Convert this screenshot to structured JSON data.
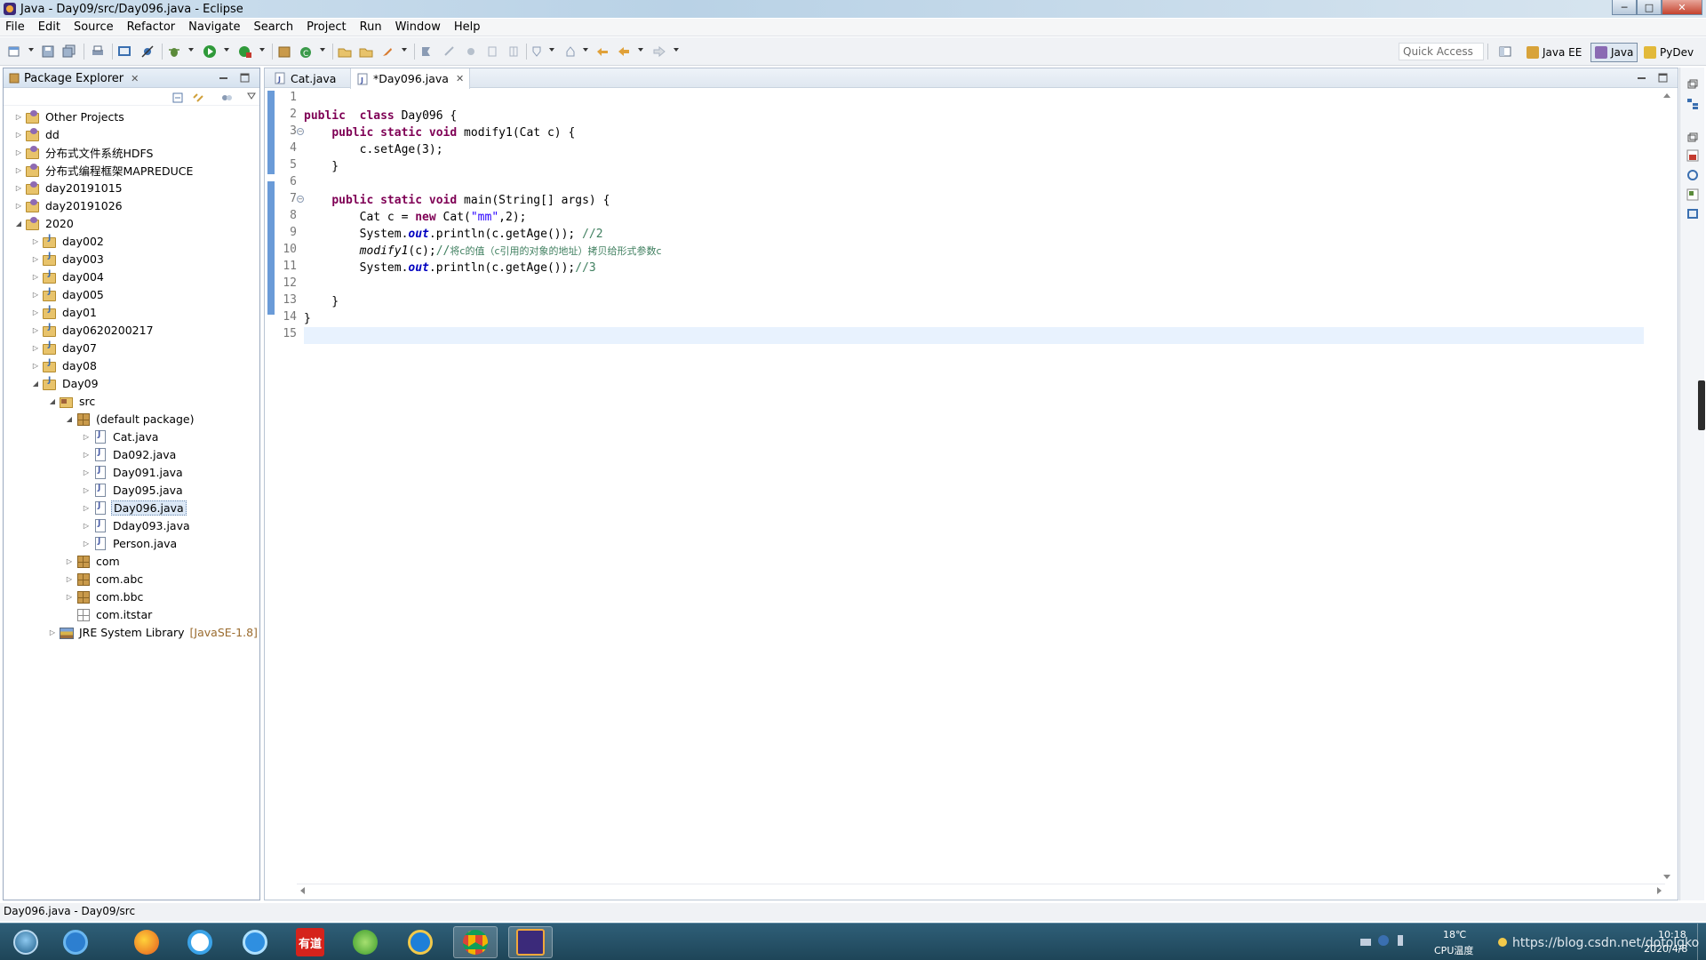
{
  "window": {
    "title": "Java - Day09/src/Day096.java - Eclipse",
    "min": "─",
    "max": "□",
    "close": "✕"
  },
  "menu": [
    "File",
    "Edit",
    "Source",
    "Refactor",
    "Navigate",
    "Search",
    "Project",
    "Run",
    "Window",
    "Help"
  ],
  "toolbar": {
    "quick_access": "Quick Access",
    "perspectives": [
      {
        "label": "Java EE",
        "icon": "java-ee-icon",
        "active": false
      },
      {
        "label": "Java",
        "icon": "java-perspective-icon",
        "active": true
      },
      {
        "label": "PyDev",
        "icon": "pydev-icon",
        "active": false
      }
    ]
  },
  "package_explorer": {
    "tab_label": "Package Explorer",
    "close": "✕",
    "tree": [
      {
        "label": "Other Projects",
        "depth": 0,
        "arrow": "▷",
        "icon": "project"
      },
      {
        "label": "dd",
        "depth": 0,
        "arrow": "▷",
        "icon": "project"
      },
      {
        "label": "分布式文件系统HDFS",
        "depth": 0,
        "arrow": "▷",
        "icon": "project"
      },
      {
        "label": "分布式编程框架MAPREDUCE",
        "depth": 0,
        "arrow": "▷",
        "icon": "project"
      },
      {
        "label": "day20191015",
        "depth": 0,
        "arrow": "▷",
        "icon": "project"
      },
      {
        "label": "day20191026",
        "depth": 0,
        "arrow": "▷",
        "icon": "project"
      },
      {
        "label": "2020",
        "depth": 0,
        "arrow": "◢",
        "icon": "project"
      },
      {
        "label": "day002",
        "depth": 1,
        "arrow": "▷",
        "icon": "jproject"
      },
      {
        "label": "day003",
        "depth": 1,
        "arrow": "▷",
        "icon": "jproject"
      },
      {
        "label": "day004",
        "depth": 1,
        "arrow": "▷",
        "icon": "jproject"
      },
      {
        "label": "day005",
        "depth": 1,
        "arrow": "▷",
        "icon": "jproject"
      },
      {
        "label": "day01",
        "depth": 1,
        "arrow": "▷",
        "icon": "jproject"
      },
      {
        "label": "day0620200217",
        "depth": 1,
        "arrow": "▷",
        "icon": "jproject"
      },
      {
        "label": "day07",
        "depth": 1,
        "arrow": "▷",
        "icon": "jproject"
      },
      {
        "label": "day08",
        "depth": 1,
        "arrow": "▷",
        "icon": "jproject"
      },
      {
        "label": "Day09",
        "depth": 1,
        "arrow": "◢",
        "icon": "jproject"
      },
      {
        "label": "src",
        "depth": 2,
        "arrow": "◢",
        "icon": "src"
      },
      {
        "label": "(default package)",
        "depth": 3,
        "arrow": "◢",
        "icon": "pkg"
      },
      {
        "label": "Cat.java",
        "depth": 4,
        "arrow": "▷",
        "icon": "java"
      },
      {
        "label": "Da092.java",
        "depth": 4,
        "arrow": "▷",
        "icon": "java"
      },
      {
        "label": "Day091.java",
        "depth": 4,
        "arrow": "▷",
        "icon": "java"
      },
      {
        "label": "Day095.java",
        "depth": 4,
        "arrow": "▷",
        "icon": "java"
      },
      {
        "label": "Day096.java",
        "depth": 4,
        "arrow": "▷",
        "icon": "java",
        "selected": true
      },
      {
        "label": "Dday093.java",
        "depth": 4,
        "arrow": "▷",
        "icon": "java"
      },
      {
        "label": "Person.java",
        "depth": 4,
        "arrow": "▷",
        "icon": "java"
      },
      {
        "label": "com",
        "depth": 3,
        "arrow": "▷",
        "icon": "pkg"
      },
      {
        "label": "com.abc",
        "depth": 3,
        "arrow": "▷",
        "icon": "pkg"
      },
      {
        "label": "com.bbc",
        "depth": 3,
        "arrow": "▷",
        "icon": "pkg"
      },
      {
        "label": "com.itstar",
        "depth": 3,
        "arrow": "",
        "icon": "pkg-empty"
      },
      {
        "label": "JRE System Library",
        "depth": 2,
        "arrow": "▷",
        "icon": "jre",
        "suffix": "[JavaSE-1.8]"
      }
    ]
  },
  "editor": {
    "tabs": [
      {
        "label": "Cat.java",
        "active": false,
        "close": ""
      },
      {
        "label": "*Day096.java",
        "active": true,
        "close": "✕"
      }
    ],
    "lines": [
      [],
      [
        [
          "kw",
          "public"
        ],
        [
          "",
          "  "
        ],
        [
          "kw",
          "class"
        ],
        [
          "",
          " Day096 {"
        ]
      ],
      [
        [
          "",
          "    "
        ],
        [
          "kw",
          "public"
        ],
        [
          "",
          " "
        ],
        [
          "kw",
          "static"
        ],
        [
          "",
          " "
        ],
        [
          "kw",
          "void"
        ],
        [
          "",
          " modify1(Cat c) {"
        ]
      ],
      [
        [
          "",
          "        c.setAge(3);"
        ]
      ],
      [
        [
          "",
          "    }"
        ]
      ],
      [],
      [
        [
          "",
          "    "
        ],
        [
          "kw",
          "public"
        ],
        [
          "",
          " "
        ],
        [
          "kw",
          "static"
        ],
        [
          "",
          " "
        ],
        [
          "kw",
          "void"
        ],
        [
          "",
          " main(String[] args) {"
        ]
      ],
      [
        [
          "",
          "        Cat c = "
        ],
        [
          "kw",
          "new"
        ],
        [
          "",
          " Cat("
        ],
        [
          "str",
          "\"mm\""
        ],
        [
          "",
          ",2);"
        ]
      ],
      [
        [
          "",
          "        System."
        ],
        [
          "fld",
          "out"
        ],
        [
          "",
          ".println(c.getAge()); "
        ],
        [
          "cmt",
          "//2"
        ]
      ],
      [
        [
          "",
          "        "
        ],
        [
          "stat",
          "modify1"
        ],
        [
          "",
          "(c);"
        ],
        [
          "cmt",
          "//"
        ],
        [
          "cmt-cn",
          "将c的值（c引用的对象的地址）拷贝给形式参数c"
        ]
      ],
      [
        [
          "",
          "        System."
        ],
        [
          "fld",
          "out"
        ],
        [
          "",
          ".println(c.getAge());"
        ],
        [
          "cmt",
          "//3"
        ]
      ],
      [],
      [
        [
          "",
          "    }"
        ]
      ],
      [
        [
          "",
          "}"
        ]
      ],
      []
    ],
    "line_numbers": [
      "1",
      "2",
      "3",
      "4",
      "5",
      "6",
      "7",
      "8",
      "9",
      "10",
      "11",
      "12",
      "13",
      "14",
      "15"
    ],
    "current_line_index": 14
  },
  "status": {
    "text": "Day096.java - Day09/src"
  },
  "taskbar": {
    "temperature": "18℃",
    "cpu_label": "CPU温度",
    "url_watermark": "https://blog.csdn.net/dotolgko",
    "time": "10:18",
    "date": "2020/4/8",
    "youdao": "有道"
  }
}
